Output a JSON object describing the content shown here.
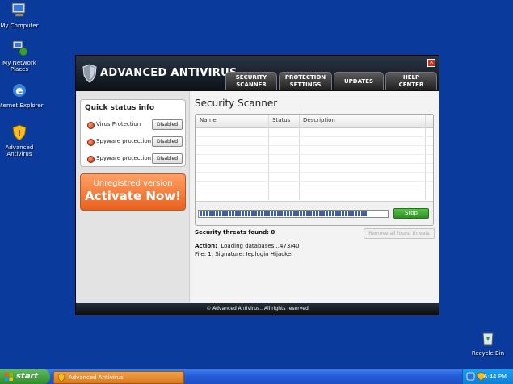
{
  "desktop": {
    "icons": [
      {
        "label": "My Computer",
        "icon": "my-computer-icon"
      },
      {
        "label": "My Network Places",
        "icon": "network-places-icon"
      },
      {
        "label": "Internet Explorer",
        "icon": "internet-explorer-icon"
      },
      {
        "label": "Advanced Antivirus",
        "icon": "antivirus-shield-icon"
      },
      {
        "label": "Recycle Bin",
        "icon": "recycle-bin-icon"
      }
    ],
    "background_color": "#0a3a9c"
  },
  "window": {
    "title": "ADVANCED ANTIVIRUS",
    "close_icon": "close-icon",
    "tabs": [
      {
        "line1": "SECURITY",
        "line2": "SCANNER"
      },
      {
        "line1": "PROTECTION",
        "line2": "SETTINGS"
      },
      {
        "line1": "UPDATES",
        "line2": ""
      },
      {
        "line1": "HELP",
        "line2": "CENTER"
      }
    ],
    "sidebar": {
      "status_title": "Quick status info",
      "items": [
        {
          "label": "Virus Protection",
          "button": "Disabled"
        },
        {
          "label": "Spyware protection",
          "button": "Disabled"
        },
        {
          "label": "Spyware protection",
          "button": "Disabled"
        }
      ],
      "activate": {
        "line1": "Unregistred version",
        "line2": "Activate Now!"
      }
    },
    "main": {
      "title": "Security Scanner",
      "columns": [
        "Name",
        "Status",
        "Description"
      ],
      "progress": 0.9,
      "stop_label": "Stop",
      "threats_label": "Security threats found: 0",
      "remove_label": "Remove all found threats",
      "action_label": "Action:",
      "action_value": "Loading databases...473/40",
      "file_line": "File: 1, Signature: Ieplugin Hijacker"
    },
    "footer": "© Advanced Antivirus.. All rights reserved"
  },
  "taskbar": {
    "start_label": "start",
    "task_label": "Advanced Antivirus",
    "clock": "6:44 PM"
  },
  "colors": {
    "accent_orange": "#e8621e",
    "stop_green": "#2f8f25",
    "status_red": "#c02d10"
  }
}
